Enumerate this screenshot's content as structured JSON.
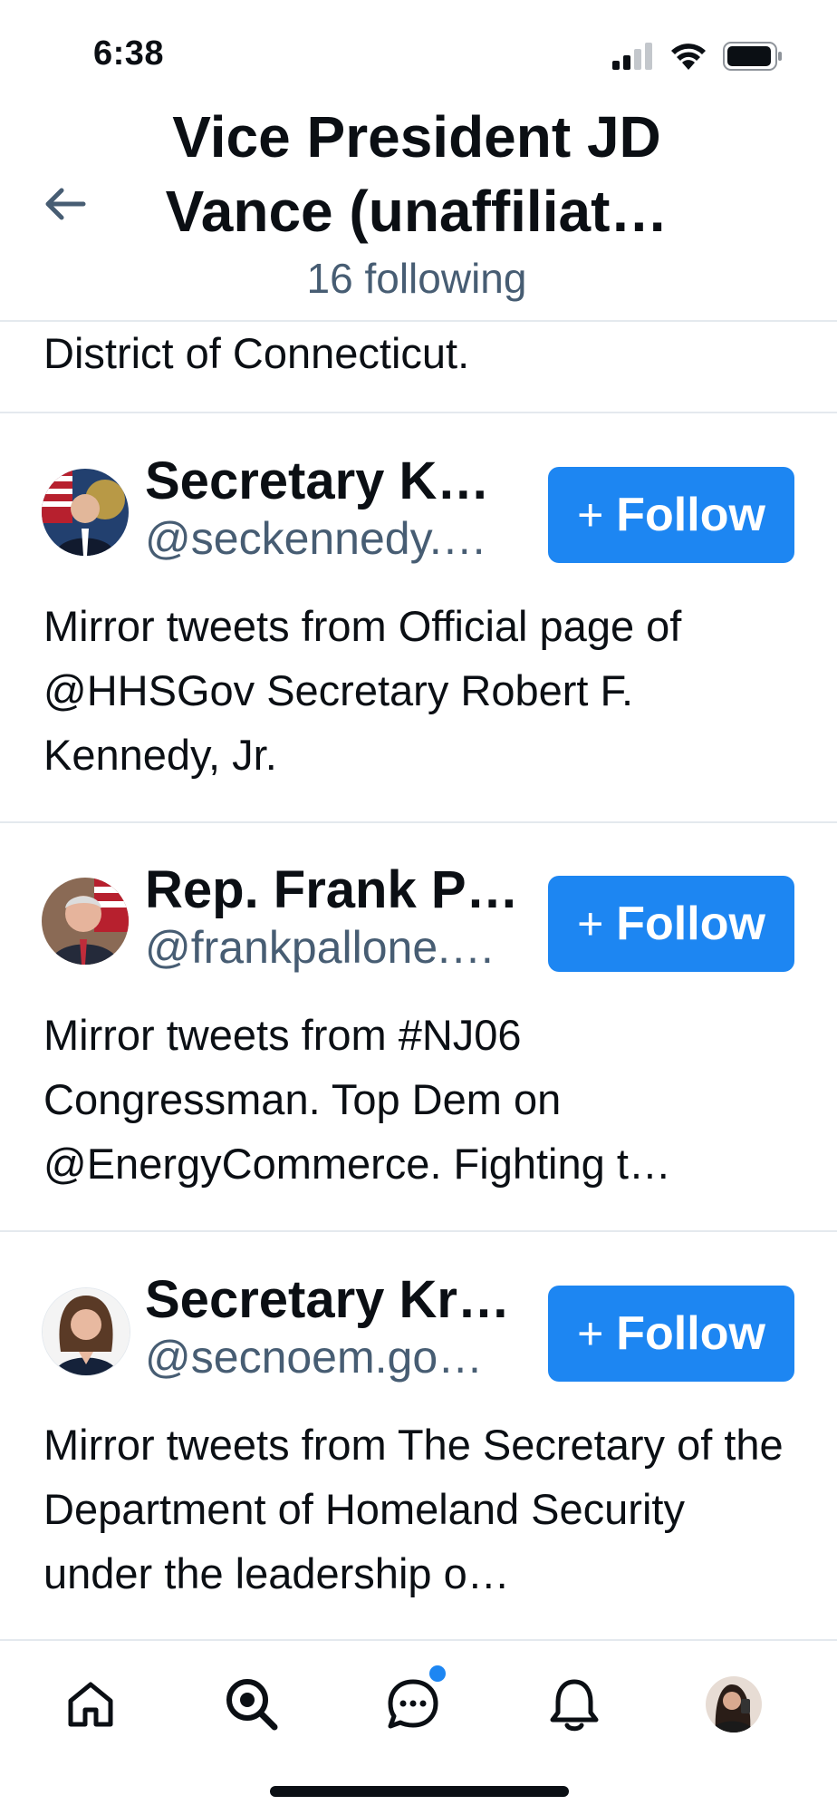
{
  "status_bar": {
    "time": "6:38"
  },
  "header": {
    "title": "Vice President JD Vance (unaffiliat…",
    "subtitle": "16 following"
  },
  "previous_item_tail": "District of Connecticut.",
  "follow_label": "Follow",
  "items": [
    {
      "name": "Secretary K…",
      "handle": "@seckennedy.…",
      "description": "Mirror tweets from Official page of @HHSGov Secretary Robert F. Kennedy, Jr."
    },
    {
      "name": "Rep. Frank P…",
      "handle": "@frankpallone.…",
      "description": "Mirror tweets from #NJ06 Congressman. Top Dem on @EnergyCommerce. Fighting t…"
    },
    {
      "name": "Secretary Kr…",
      "handle": "@secnoem.go…",
      "description": "Mirror tweets from The Secretary of the Department of Homeland Security under the leadership o…"
    }
  ],
  "tab_bar": {
    "icons": [
      "home-icon",
      "search-icon",
      "chat-icon",
      "bell-icon",
      "profile-avatar"
    ]
  },
  "colors": {
    "accent": "#1d86f2",
    "secondary_text": "#475d73",
    "divider": "#e4e9ee"
  }
}
